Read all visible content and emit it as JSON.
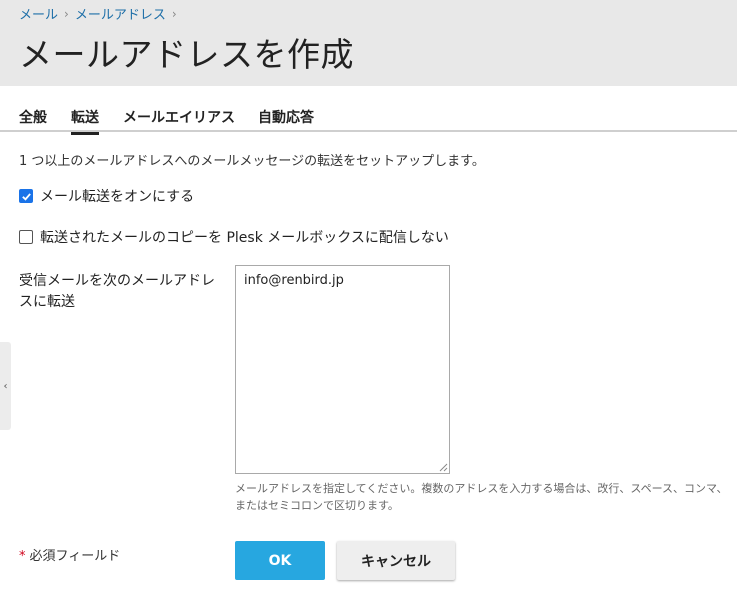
{
  "breadcrumb": {
    "items": [
      "メール",
      "メールアドレス"
    ],
    "separator": "›"
  },
  "page": {
    "title": "メールアドレスを作成"
  },
  "tabs": [
    {
      "label": "全般",
      "active": false
    },
    {
      "label": "転送",
      "active": true
    },
    {
      "label": "メールエイリアス",
      "active": false
    },
    {
      "label": "自動応答",
      "active": false
    }
  ],
  "form": {
    "description": "1 つ以上のメールアドレスへのメールメッセージの転送をセットアップします。",
    "forwarding_toggle": {
      "label": "メール転送をオンにする",
      "checked": true
    },
    "no_copy_toggle": {
      "label": "転送されたメールのコピーを Plesk メールボックスに配信しない",
      "checked": false
    },
    "forward_to": {
      "label": "受信メールを次のメールアドレスに転送",
      "value": "info@renbird.jp",
      "hint": "メールアドレスを指定してください。複数のアドレスを入力する場合は、改行、スペース、コンマ、またはセミコロンで区切ります。"
    },
    "required_note": {
      "star": "*",
      "text": "必須フィールド"
    },
    "ok_label": "OK",
    "cancel_label": "キャンセル"
  },
  "sidebar_toggle": {
    "glyph": "‹"
  },
  "colors": {
    "header_bg": "#e8e8e8",
    "link": "#1e6fa8",
    "primary_button": "#27a7e0",
    "required_star": "#d0021b",
    "checkbox": "#1a73e8"
  }
}
